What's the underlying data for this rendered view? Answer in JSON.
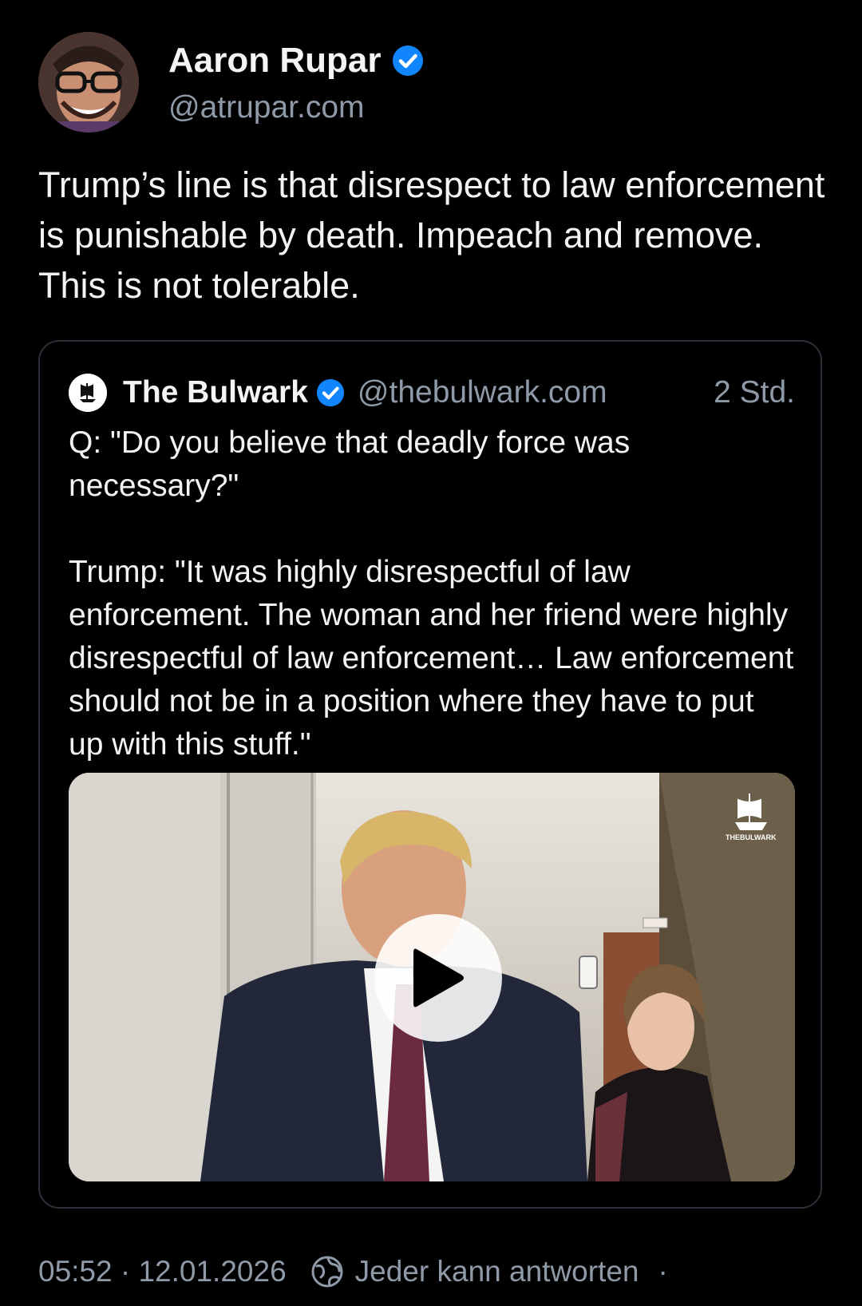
{
  "author": {
    "name": "Aaron Rupar",
    "handle": "@atrupar.com"
  },
  "post": {
    "text": "Trump’s line is that disrespect to law enforcement is punishable by death. Impeach and remove. This is not tolerable."
  },
  "quote": {
    "name": "The Bulwark",
    "handle": "@thebulwark.com",
    "time": "2 Std.",
    "text": "Q: \"Do you believe that deadly force was necessary?\"\n\nTrump: \"It was highly disrespectful of law enforcement. The woman and her friend were highly disrespectful of law enforcement… Law enforcement should not be in a position where they have to put up with this stuff.\"",
    "watermark": "THEBULWARK"
  },
  "footer": {
    "timestamp": "05:52 · 12.01.2026",
    "reply_setting": "Jeder kann antworten",
    "separator": "·"
  },
  "colors": {
    "background": "#000000",
    "verified": "#1185fe",
    "muted": "#8f9aa8"
  }
}
